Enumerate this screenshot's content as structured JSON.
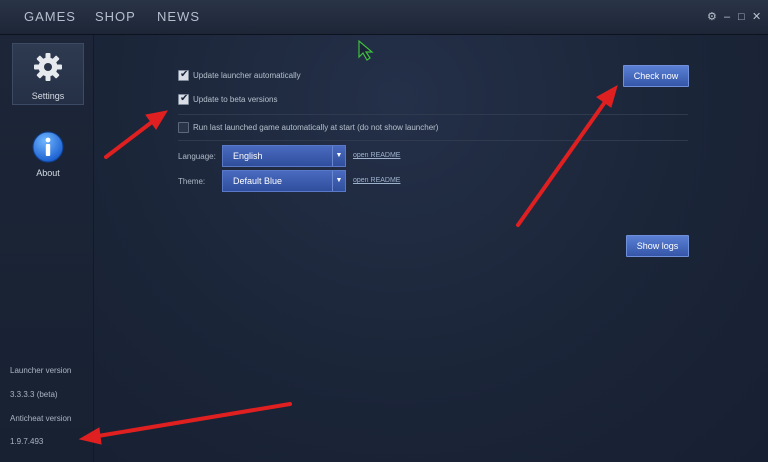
{
  "nav": [
    "GAMES",
    "SHOP",
    "NEWS"
  ],
  "window_controls": {
    "settings": "⚙",
    "minimize": "–",
    "maximize": "□",
    "close": "✕"
  },
  "sidebar": {
    "items": [
      {
        "label": "Settings",
        "icon": "gear-icon",
        "active": true
      },
      {
        "label": "About",
        "icon": "info-icon",
        "active": false
      }
    ],
    "launcher_version_label": "Launcher version",
    "launcher_version": "3.3.3.3 (beta)",
    "anticheat_version_label": "Anticheat version",
    "anticheat_version": "1.9.7.493"
  },
  "settings": {
    "update_auto": {
      "label": "Update launcher automatically",
      "checked": true
    },
    "update_beta": {
      "label": "Update to beta versions",
      "checked": true
    },
    "run_last": {
      "label": "Run last launched game automatically at start (do not show launcher)",
      "checked": false
    },
    "language_label": "Language:",
    "language_value": "English",
    "theme_label": "Theme:",
    "theme_value": "Default Blue",
    "readme_link": "open README",
    "check_now": "Check now",
    "show_logs": "Show logs"
  },
  "colors": {
    "accent": "#4767c0",
    "annotation": "#e02020",
    "background": "#1a2436"
  }
}
